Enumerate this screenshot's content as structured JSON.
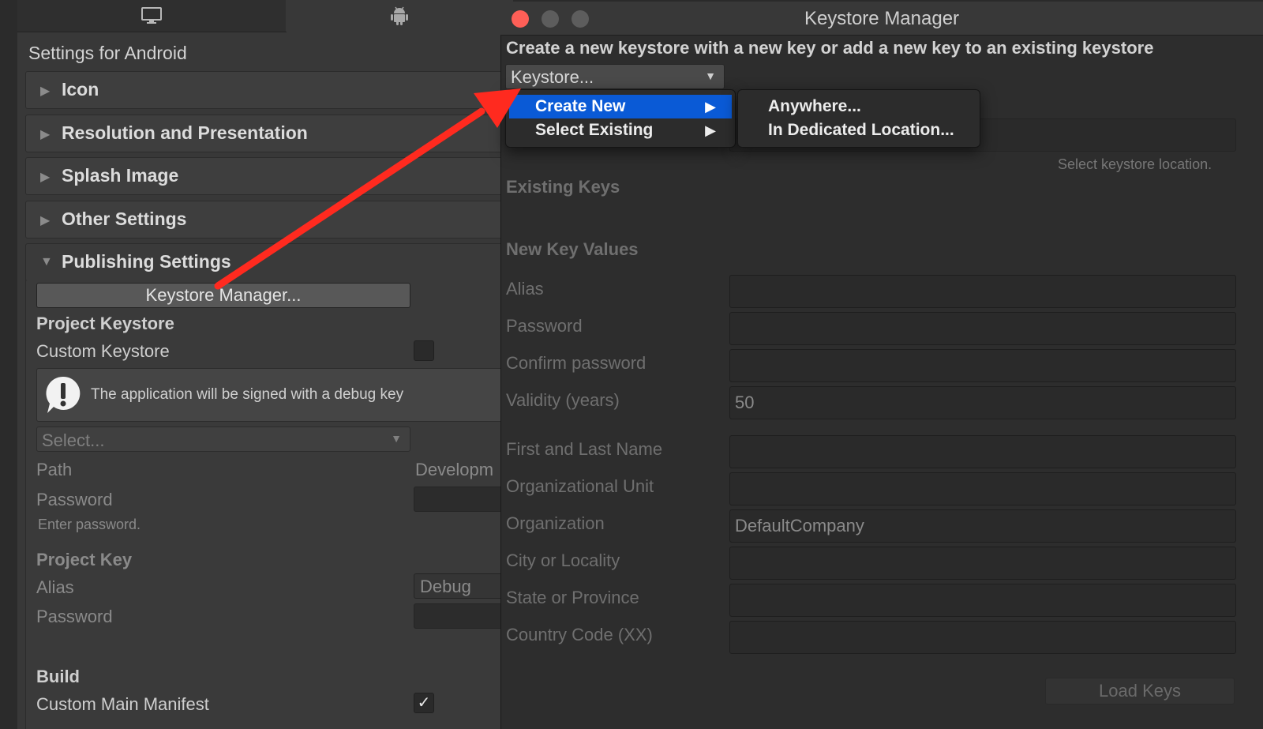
{
  "left_panel": {
    "tabs": [
      {
        "icon": "monitor-icon"
      },
      {
        "icon": "android-icon"
      }
    ],
    "title": "Settings for Android",
    "sections": [
      {
        "label": "Icon",
        "expanded": false
      },
      {
        "label": "Resolution and Presentation",
        "expanded": false
      },
      {
        "label": "Splash Image",
        "expanded": false
      },
      {
        "label": "Other Settings",
        "expanded": false
      },
      {
        "label": "Publishing Settings",
        "expanded": true
      }
    ],
    "publishing": {
      "keystore_manager_button": "Keystore Manager...",
      "project_keystore_heading": "Project Keystore",
      "custom_keystore_label": "Custom Keystore",
      "custom_keystore_checked": false,
      "help_text": "The application will be signed with a debug key",
      "select_placeholder": "Select...",
      "path_label": "Path",
      "path_value": "Developm",
      "password_label": "Password",
      "password_hint": "Enter password.",
      "project_key_heading": "Project Key",
      "alias_label": "Alias",
      "alias_value": "Debug",
      "key_password_label": "Password",
      "build_heading": "Build",
      "custom_manifest_label": "Custom Main Manifest",
      "custom_manifest_checked": true,
      "checkmark": "✓"
    }
  },
  "keystore_window": {
    "title": "Keystore Manager",
    "header": "Create a new keystore with a new key or add a new key to an existing keystore",
    "keystore_dropdown": "Keystore...",
    "keystore_hint": "Select keystore location.",
    "existing_keys_heading": "Existing Keys",
    "new_key_values_heading": "New Key Values",
    "fields": [
      {
        "label": "Alias",
        "value": ""
      },
      {
        "label": "Password",
        "value": ""
      },
      {
        "label": "Confirm password",
        "value": ""
      },
      {
        "label": "Validity (years)",
        "value": "50"
      },
      {
        "label": "First and Last Name",
        "value": ""
      },
      {
        "label": "Organizational Unit",
        "value": ""
      },
      {
        "label": "Organization",
        "value": "DefaultCompany"
      },
      {
        "label": "City or Locality",
        "value": ""
      },
      {
        "label": "State or Province",
        "value": ""
      },
      {
        "label": "Country Code (XX)",
        "value": ""
      }
    ],
    "load_keys_button": "Load Keys"
  },
  "dropdown_menu": {
    "items": [
      {
        "label": "Create New",
        "highlighted": true,
        "submenu_arrow": "▶"
      },
      {
        "label": "Select Existing",
        "highlighted": false,
        "submenu_arrow": "▶"
      }
    ]
  },
  "submenu": {
    "items": [
      {
        "label": "Anywhere..."
      },
      {
        "label": "In Dedicated Location..."
      }
    ]
  },
  "colors": {
    "highlight": "#0a5ad6",
    "annotation_arrow": "#ff2a1f",
    "close_light": "#fe5f57"
  }
}
